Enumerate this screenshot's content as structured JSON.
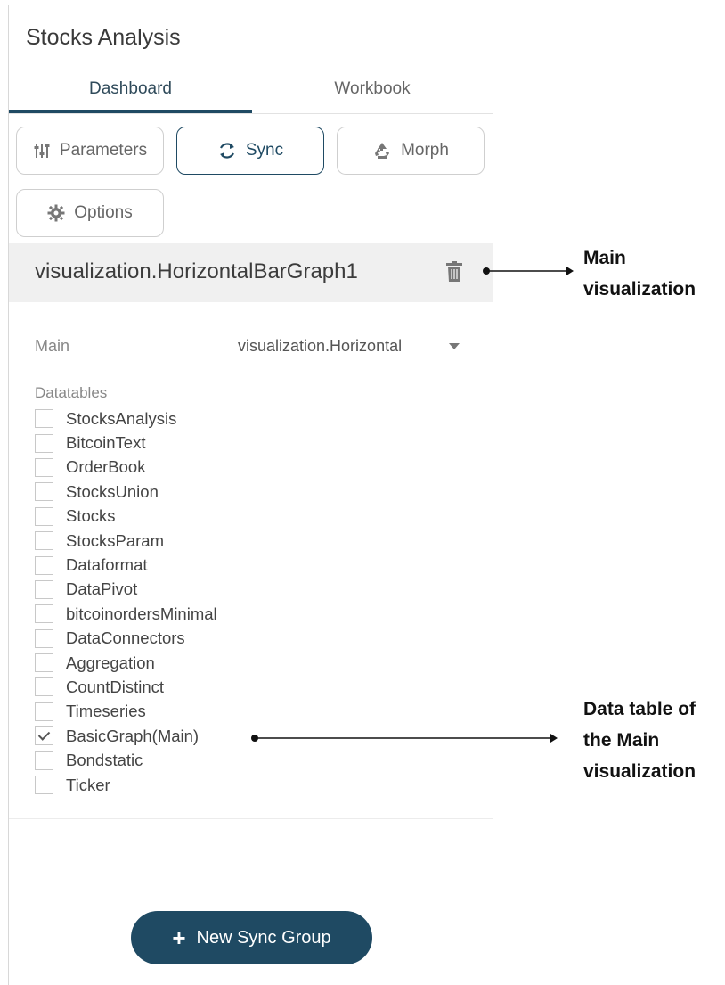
{
  "panel": {
    "title": "Stocks Analysis",
    "tabs": [
      {
        "label": "Dashboard",
        "active": true
      },
      {
        "label": "Workbook",
        "active": false
      }
    ],
    "toolbar": {
      "parameters_label": "Parameters",
      "sync_label": "Sync",
      "morph_label": "Morph",
      "options_label": "Options"
    },
    "visualization": {
      "name": "visualization.HorizontalBarGraph1"
    },
    "main": {
      "label": "Main",
      "selected": "visualization.Horizontal"
    },
    "datatables": {
      "label": "Datatables",
      "items": [
        {
          "name": "StocksAnalysis",
          "checked": false
        },
        {
          "name": "BitcoinText",
          "checked": false
        },
        {
          "name": "OrderBook",
          "checked": false
        },
        {
          "name": "StocksUnion",
          "checked": false
        },
        {
          "name": "Stocks",
          "checked": false
        },
        {
          "name": "StocksParam",
          "checked": false
        },
        {
          "name": "Dataformat",
          "checked": false
        },
        {
          "name": "DataPivot",
          "checked": false
        },
        {
          "name": "bitcoinordersMinimal",
          "checked": false
        },
        {
          "name": "DataConnectors",
          "checked": false
        },
        {
          "name": "Aggregation",
          "checked": false
        },
        {
          "name": "CountDistinct",
          "checked": false
        },
        {
          "name": "Timeseries",
          "checked": false
        },
        {
          "name": "BasicGraph(Main)",
          "checked": true
        },
        {
          "name": "Bondstatic",
          "checked": false
        },
        {
          "name": "Ticker",
          "checked": false
        }
      ]
    },
    "new_sync_group": {
      "icon": "plus-icon",
      "label": "New Sync Group"
    }
  },
  "annotations": {
    "main_visualization": [
      "Main",
      "visualization"
    ],
    "data_table": [
      "Data table of",
      "the Main",
      "visualization"
    ]
  },
  "colors": {
    "accent": "#1f4a63",
    "header_bg": "#f0f0f0"
  }
}
